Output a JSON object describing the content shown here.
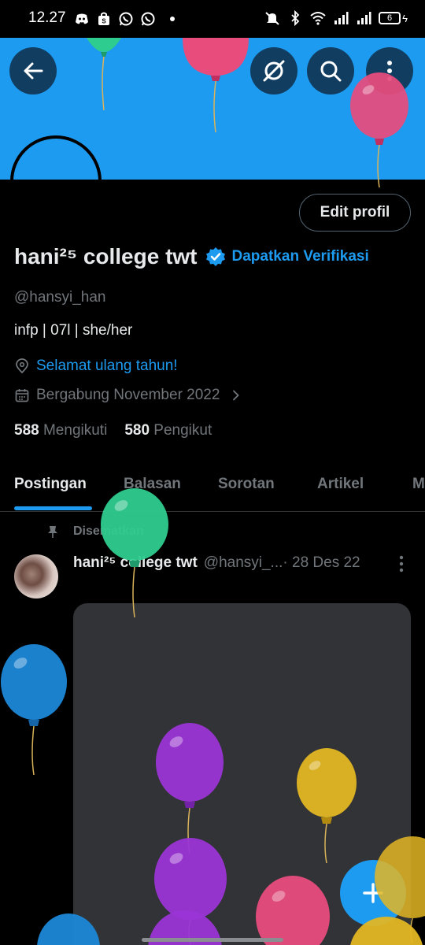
{
  "status_bar": {
    "time": "12.27",
    "battery": "6",
    "icons_left": [
      "discord-icon",
      "shop-icon",
      "whatsapp-icon",
      "whatsapp-icon"
    ],
    "icons_right": [
      "mute-icon",
      "bluetooth-icon",
      "wifi-icon",
      "signal-icon",
      "signal-icon",
      "battery-icon"
    ]
  },
  "header": {
    "buttons": [
      "back-arrow-icon",
      "grok-icon",
      "search-icon",
      "more-vertical-icon"
    ]
  },
  "profile": {
    "edit_button": "Edit profil",
    "display_name": "hani²⁵ college twt",
    "get_verified": "Dapatkan Verifikasi",
    "handle": "@hansyi_han",
    "bio": "infp | 07l | she/her",
    "birthday": "Selamat ulang tahun!",
    "joined": "Bergabung November 2022",
    "following_count": "588",
    "following_label": "Mengikuti",
    "followers_count": "580",
    "followers_label": "Pengikut"
  },
  "tabs": [
    {
      "label": "Postingan",
      "active": true
    },
    {
      "label": "Balasan",
      "active": false
    },
    {
      "label": "Sorotan",
      "active": false
    },
    {
      "label": "Artikel",
      "active": false
    },
    {
      "label": "M",
      "active": false
    }
  ],
  "pinned_post": {
    "pinned_label": "Disematkan",
    "author_name": "hani²⁵ college twt",
    "author_handle": "@hansyi_...",
    "date": "· 28 Des 22"
  },
  "colors": {
    "accent": "#1d9bf0",
    "background": "#000000",
    "muted_text": "#71767b",
    "banner": "#1d9bf0",
    "balloons": [
      "#2ecc8f",
      "#e84c7d",
      "#1e88d8",
      "#9b35d6",
      "#e3b623"
    ]
  }
}
